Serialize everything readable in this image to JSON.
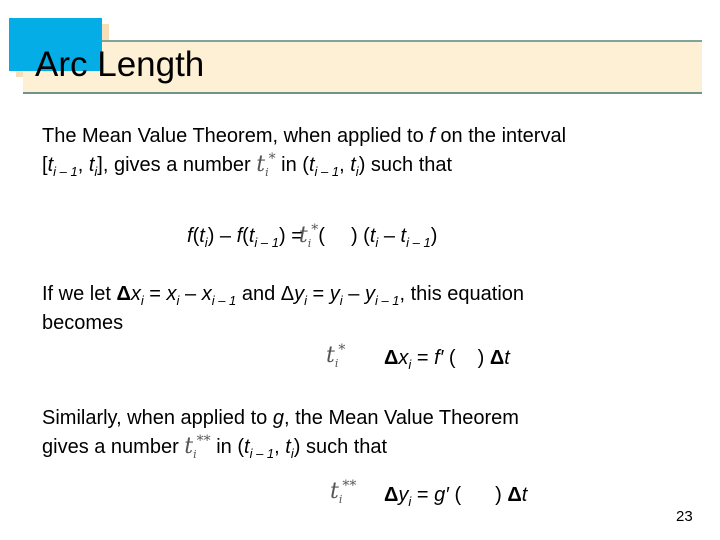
{
  "slide": {
    "title": "Arc Length",
    "page_number": "23",
    "colors": {
      "title_square": "#05ade6",
      "title_bar": "#fdf0d5",
      "title_shadow": "#f6dfb8",
      "title_rule": "#7fa49a"
    }
  },
  "paragraph1": {
    "line1_prefix": "The Mean Value Theorem, when applied to ",
    "line1_f": "f",
    "line1_suffix": " on the interval",
    "line2_open": "[",
    "t": "t",
    "i": "i",
    "i_minus_1": "i – 1",
    "comma": ", ",
    "line2_close": "], gives a number ",
    "line2_in": " in (",
    "line2_end": ") such that"
  },
  "equation1": {
    "f": "f",
    "minus": " – ",
    "equals": " =",
    "open": "(",
    "close": ") (",
    "end": ")"
  },
  "paragraph2": {
    "line1_a": "If we let ",
    "delta": "Δ",
    "x": "x",
    "y": "y",
    "eq": " = ",
    "minus": " – ",
    "and": " and ",
    "line1_end": ", this equation",
    "line2": "becomes"
  },
  "equation2": {
    "lhs_delta": "Δ",
    "lhs_var": "x",
    "eq": " = ",
    "func": "f′",
    "open": " (",
    "close": ") ",
    "dt": "Δ",
    "t": "t"
  },
  "paragraph3": {
    "line1_a": "Similarly, when applied to ",
    "g": "g",
    "line1_b": ", the Mean Value Theorem",
    "line2_a": "gives a number ",
    "line2_in": " in (",
    "line2_end": ") such that"
  },
  "equation3": {
    "lhs_delta": "Δ",
    "lhs_var": "y",
    "eq": " = ",
    "func": "g′",
    "open": " (",
    "close": ") ",
    "dt": "Δ",
    "t": "t"
  },
  "symbols": {
    "t": "t",
    "i": "i",
    "star": "*",
    "star2": "**"
  }
}
